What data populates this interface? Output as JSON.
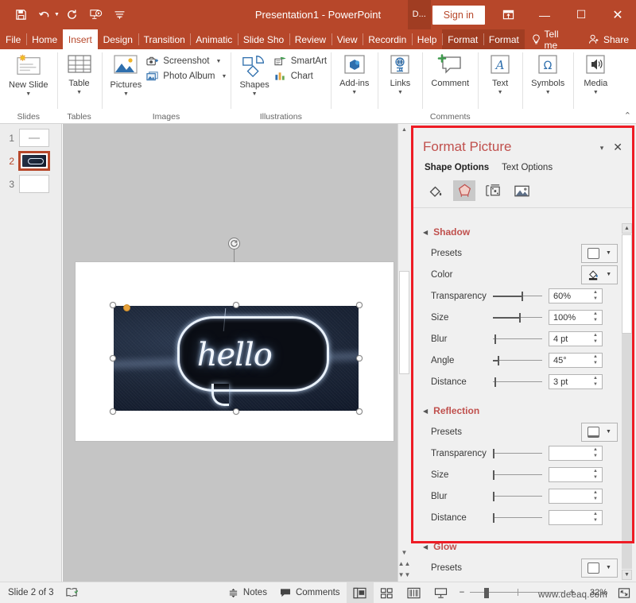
{
  "titlebar": {
    "quick_access": [
      {
        "name": "save",
        "glyph": "💾"
      },
      {
        "name": "undo",
        "glyph": "↶"
      },
      {
        "name": "redo",
        "glyph": "↻"
      },
      {
        "name": "start-from-beginning",
        "glyph": "▷"
      },
      {
        "name": "customize-quick-access-toolbar",
        "glyph": "☰"
      }
    ],
    "document_title": "Presentation1  -  PowerPoint",
    "account_hint": "D...",
    "sign_in_label": "Sign in",
    "ribbon_display_options": "ribbon-display-options-icon",
    "minimize": "—",
    "maximize": "☐",
    "close": "✕"
  },
  "ribbon": {
    "tabs": [
      {
        "label": "File",
        "state": "normal"
      },
      {
        "label": "Home",
        "state": "normal"
      },
      {
        "label": "Insert",
        "state": "active"
      },
      {
        "label": "Design",
        "state": "normal"
      },
      {
        "label": "Transition",
        "state": "normal"
      },
      {
        "label": "Animatic",
        "state": "normal"
      },
      {
        "label": "Slide Sho",
        "state": "normal"
      },
      {
        "label": "Review",
        "state": "normal"
      },
      {
        "label": "View",
        "state": "normal"
      },
      {
        "label": "Recordin",
        "state": "normal"
      },
      {
        "label": "Help",
        "state": "normal"
      },
      {
        "label": "Format",
        "state": "contextual"
      },
      {
        "label": "Format",
        "state": "contextual"
      }
    ],
    "tell_me": "Tell me",
    "share": "Share",
    "groups": [
      {
        "name": "slides",
        "label": "Slides",
        "buttons": [
          {
            "label": "New Slide",
            "caret": true,
            "icon": "new-slide-icon"
          }
        ]
      },
      {
        "name": "tables",
        "label": "Tables",
        "buttons": [
          {
            "label": "Table",
            "caret": true,
            "icon": "table-icon"
          }
        ]
      },
      {
        "name": "images",
        "label": "Images",
        "buttons": [
          {
            "label": "Pictures",
            "caret": true,
            "icon": "pictures-icon"
          }
        ],
        "small_buttons": [
          {
            "label": "Screenshot",
            "caret": true,
            "icon": "screenshot-icon"
          },
          {
            "label": "Photo Album",
            "caret": true,
            "icon": "photo-album-icon"
          }
        ]
      },
      {
        "name": "illustrations",
        "label": "Illustrations",
        "buttons": [
          {
            "label": "Shapes",
            "caret": true,
            "icon": "shapes-icon"
          }
        ],
        "small_buttons": [
          {
            "label": "SmartArt",
            "caret": false,
            "icon": "smartart-icon"
          },
          {
            "label": "Chart",
            "caret": false,
            "icon": "chart-icon"
          }
        ]
      },
      {
        "name": "add-ins",
        "label": "",
        "buttons": [
          {
            "label": "Add-ins",
            "caret": true,
            "icon": "add-ins-icon"
          }
        ]
      },
      {
        "name": "links",
        "label": "",
        "buttons": [
          {
            "label": "Links",
            "caret": true,
            "icon": "links-icon"
          }
        ]
      },
      {
        "name": "comments",
        "label": "Comments",
        "buttons": [
          {
            "label": "Comment",
            "caret": false,
            "icon": "comment-icon"
          }
        ]
      },
      {
        "name": "text",
        "label": "",
        "buttons": [
          {
            "label": "Text",
            "caret": true,
            "icon": "text-icon"
          }
        ]
      },
      {
        "name": "symbols",
        "label": "",
        "buttons": [
          {
            "label": "Symbols",
            "caret": true,
            "icon": "symbols-icon"
          }
        ]
      },
      {
        "name": "media",
        "label": "",
        "buttons": [
          {
            "label": "Media",
            "caret": true,
            "icon": "media-icon"
          }
        ]
      }
    ],
    "collapse_glyph": "⌃"
  },
  "slides_pane": {
    "slides": [
      {
        "number": "1",
        "selected": false
      },
      {
        "number": "2",
        "selected": true
      },
      {
        "number": "3",
        "selected": false
      }
    ]
  },
  "canvas": {
    "picture_alt": "neon hello speech bubble sign on denim",
    "picture_word": "hello",
    "rotate_handle": "rotate-handle-icon"
  },
  "format_pane": {
    "title": "Format Picture",
    "caret_glyph": "▾",
    "close_glyph": "✕",
    "tabs": [
      {
        "label": "Shape Options",
        "active": true
      },
      {
        "label": "Text Options",
        "active": false
      }
    ],
    "category_icons": [
      {
        "name": "fill-and-line-icon",
        "selected": false
      },
      {
        "name": "effects-icon",
        "selected": true
      },
      {
        "name": "size-and-properties-icon",
        "selected": false
      },
      {
        "name": "picture-icon",
        "selected": false
      }
    ],
    "sections": [
      {
        "name": "shadow",
        "title": "Shadow",
        "expanded": true,
        "rows": [
          {
            "type": "preset",
            "label": "Presets",
            "accesskey": "P",
            "control": "shadow-presets-dropdown"
          },
          {
            "type": "color",
            "label": "Color",
            "accesskey": "C",
            "control": "shadow-color-dropdown"
          },
          {
            "type": "slider",
            "label": "Transparency",
            "accesskey": "T",
            "value": "60%",
            "fill_pct": 60
          },
          {
            "type": "slider",
            "label": "Size",
            "accesskey": "S",
            "value": "100%",
            "fill_pct": 55
          },
          {
            "type": "slider",
            "label": "Blur",
            "accesskey": "B",
            "value": "4 pt",
            "fill_pct": 6
          },
          {
            "type": "slider",
            "label": "Angle",
            "accesskey": "A",
            "value": "45°",
            "fill_pct": 12
          },
          {
            "type": "slider",
            "label": "Distance",
            "accesskey": "D",
            "value": "3 pt",
            "fill_pct": 6
          }
        ]
      },
      {
        "name": "reflection",
        "title": "Reflection",
        "expanded": true,
        "rows": [
          {
            "type": "preset",
            "label": "Presets",
            "accesskey": "P",
            "control": "reflection-presets-dropdown"
          },
          {
            "type": "slider",
            "label": "Transparency",
            "accesskey": "T",
            "value": "",
            "fill_pct": 0
          },
          {
            "type": "slider",
            "label": "Size",
            "accesskey": "S",
            "value": "",
            "fill_pct": 0
          },
          {
            "type": "slider",
            "label": "Blur",
            "accesskey": "B",
            "value": "",
            "fill_pct": 0
          },
          {
            "type": "slider",
            "label": "Distance",
            "accesskey": "D",
            "value": "",
            "fill_pct": 0
          }
        ]
      },
      {
        "name": "glow",
        "title": "Glow",
        "expanded": true,
        "rows": [
          {
            "type": "preset",
            "label": "Presets",
            "accesskey": "P",
            "control": "glow-presets-dropdown"
          }
        ]
      }
    ]
  },
  "statusbar": {
    "slide_indicator": "Slide 2 of 3",
    "language_icon": "accessibility-icon",
    "notes_label": "Notes",
    "comments_label": "Comments",
    "views": [
      {
        "name": "normal-view",
        "active": true
      },
      {
        "name": "slide-sorter-view",
        "active": false
      },
      {
        "name": "reading-view",
        "active": false
      },
      {
        "name": "slide-show-view",
        "active": false
      }
    ],
    "zoom_out": "−",
    "zoom_in": "+",
    "zoom_level": "32%",
    "fit_to_window": "fit-slide-to-window-icon",
    "watermark": "www.deeaq.com"
  }
}
